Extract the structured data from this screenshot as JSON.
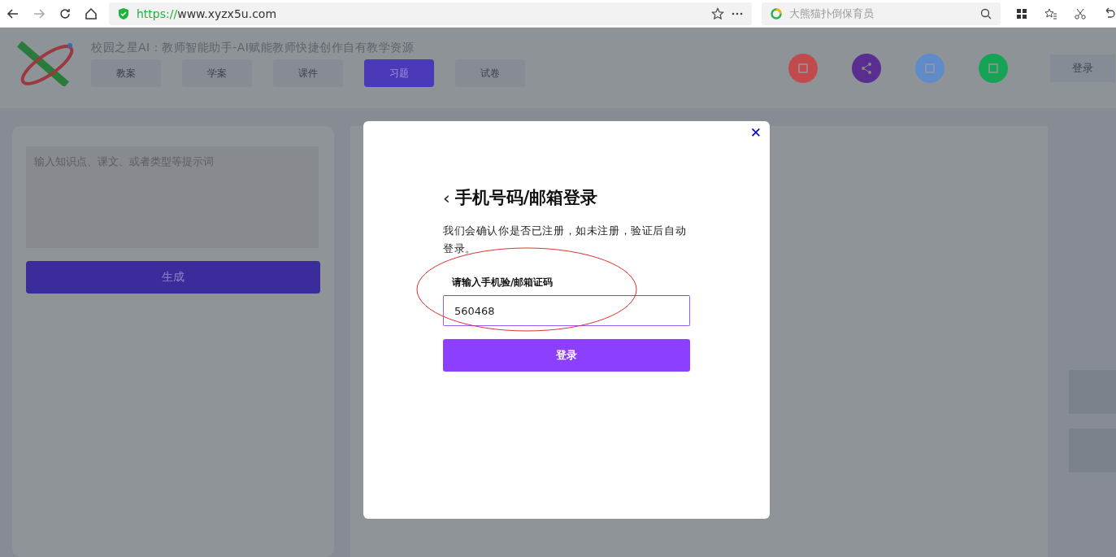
{
  "browser": {
    "url_scheme": "https://",
    "url_host": "www.xyzx5u.com",
    "search_placeholder": "大熊猫扑倒保育员"
  },
  "site": {
    "title": "校园之星AI：教师智能助手-AI赋能教师快捷创作自有教学资源",
    "tabs": [
      {
        "label": "教案",
        "selected": false
      },
      {
        "label": "学案",
        "selected": false
      },
      {
        "label": "课件",
        "selected": false
      },
      {
        "label": "习题",
        "selected": true
      },
      {
        "label": "试卷",
        "selected": false
      }
    ],
    "login": "登录"
  },
  "generator": {
    "placeholder": "输入知识点、课文、或者类型等提示词",
    "button": "生成"
  },
  "dialog": {
    "back": "‹",
    "title": "手机号码/邮箱登录",
    "description": "我们会确认你是否已注册，如未注册，验证后自动登录。",
    "field_label": "请输入手机验/邮箱证码",
    "field_value": "560468",
    "submit": "登录",
    "close": "✕"
  }
}
